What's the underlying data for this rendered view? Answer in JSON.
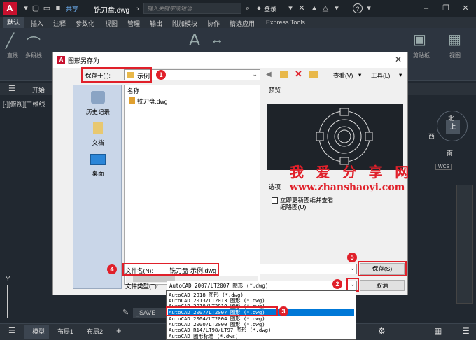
{
  "app": {
    "title": "铣刀盘.dwg",
    "share": "共享",
    "search_placeholder": "键入关键字或短语",
    "login": "登录"
  },
  "ribbon_tabs": [
    "默认",
    "插入",
    "注释",
    "参数化",
    "视图",
    "管理",
    "输出",
    "附加模块",
    "协作",
    "精选应用",
    "Express Tools"
  ],
  "ribbon_labels": {
    "line": "直线",
    "polyline": "多段线",
    "clipboard": "剪贴板",
    "view": "视图"
  },
  "file_tabs": {
    "start": "开始",
    "viewport_label": "[-][俯视][二维线"
  },
  "navcube": {
    "north": "北",
    "up": "上",
    "south": "南",
    "west": "西",
    "wcs": "WCS"
  },
  "layout_tabs": [
    "模型",
    "布局1",
    "布局2"
  ],
  "command_prompt": "_SAVE",
  "dialog": {
    "title": "图形另存为",
    "save_in_label": "保存于(I):",
    "save_in_value": "示例",
    "view_menu": "查看(V)",
    "tools_menu": "工具(L)",
    "places": [
      "历史记录",
      "文档",
      "桌面"
    ],
    "list_header": "名称",
    "files": [
      "铣刀盘.dwg"
    ],
    "preview_label": "预览",
    "options_label": "选项",
    "options_checkbox": "立即更新图纸并查看缩略图(U)",
    "filename_label": "文件名(N):",
    "filename_value": "铣刀盘-示例.dwg",
    "filetype_label": "文件类型(T):",
    "filetype_value": "AutoCAD 2007/LT2007 图形 (*.dwg)",
    "save_button": "保存(S)",
    "cancel_button": "取消",
    "filetype_options": [
      "AutoCAD 2018 图形 (*.dwg)",
      "AutoCAD 2013/LT2013 图形 (*.dwg)",
      "AutoCAD 2010/LT2010 图形 (*.dwg)",
      "AutoCAD 2007/LT2007 图形 (*.dwg)",
      "AutoCAD 2004/LT2004 图形 (*.dwg)",
      "AutoCAD 2000/LT2000 图形 (*.dwg)",
      "AutoCAD R14/LT98/LT97 图形 (*.dwg)",
      "AutoCAD 图形标准 (*.dws)"
    ],
    "selected_option_index": 3
  },
  "annotations": [
    "1",
    "2",
    "3",
    "4",
    "5"
  ],
  "watermark": {
    "chinese": "我 爱 分 享 网",
    "url": "www.zhanshaoyi.com"
  },
  "colors": {
    "accent": "#e0202a",
    "selection": "#0078d7",
    "brand": "#c8102e"
  }
}
